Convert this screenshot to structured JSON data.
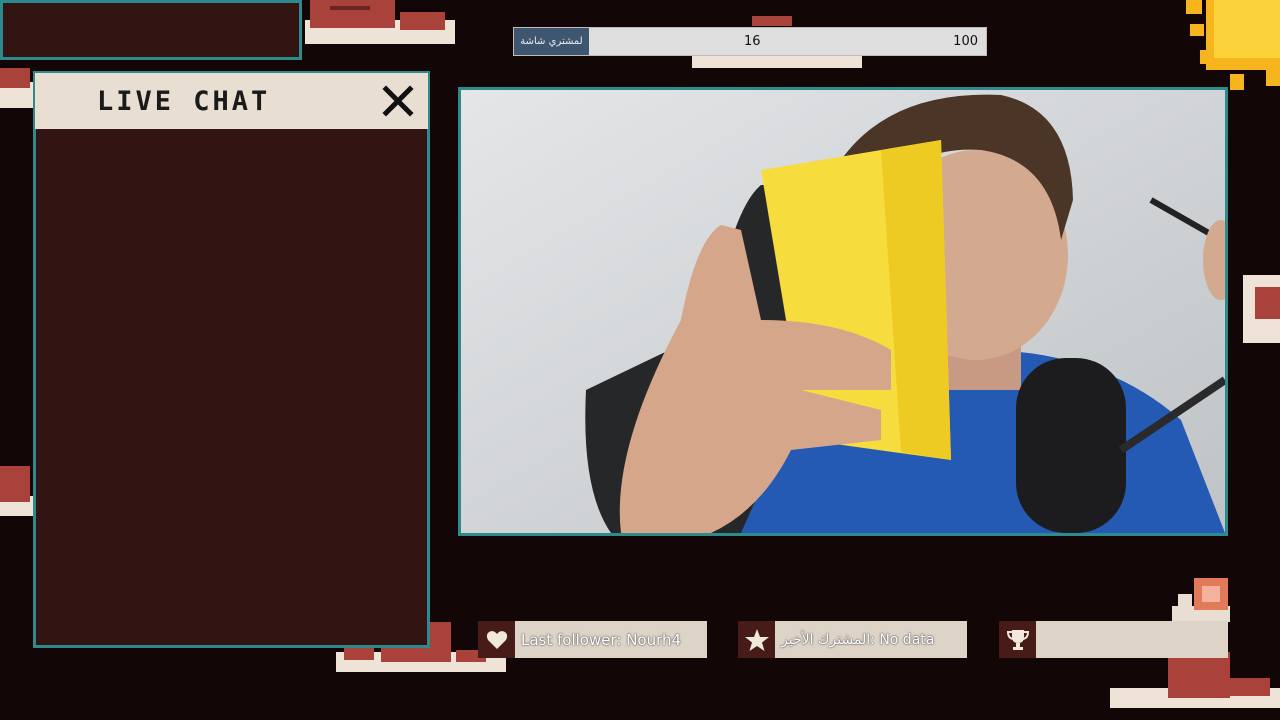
{
  "goal_bar": {
    "label": "لمشتري شاشة",
    "current": "16",
    "target": "100",
    "progress_fraction": 0.16
  },
  "chat": {
    "title": "LIVE CHAT",
    "close_icon": "close-icon"
  },
  "widgets": {
    "follower": {
      "icon": "heart-icon",
      "text": "Last follower: Nourh4"
    },
    "subscriber": {
      "icon": "star-icon",
      "text": "المشترك الأخير: No data"
    },
    "trophy": {
      "icon": "trophy-icon",
      "text": ""
    }
  },
  "colors": {
    "background": "#130607",
    "panel": "#321412",
    "border_teal": "#2e8a8c",
    "header_cream": "#e8dfd2",
    "widget_icon_bg": "#471c18",
    "widget_text_bg": "#ddd3c7"
  }
}
